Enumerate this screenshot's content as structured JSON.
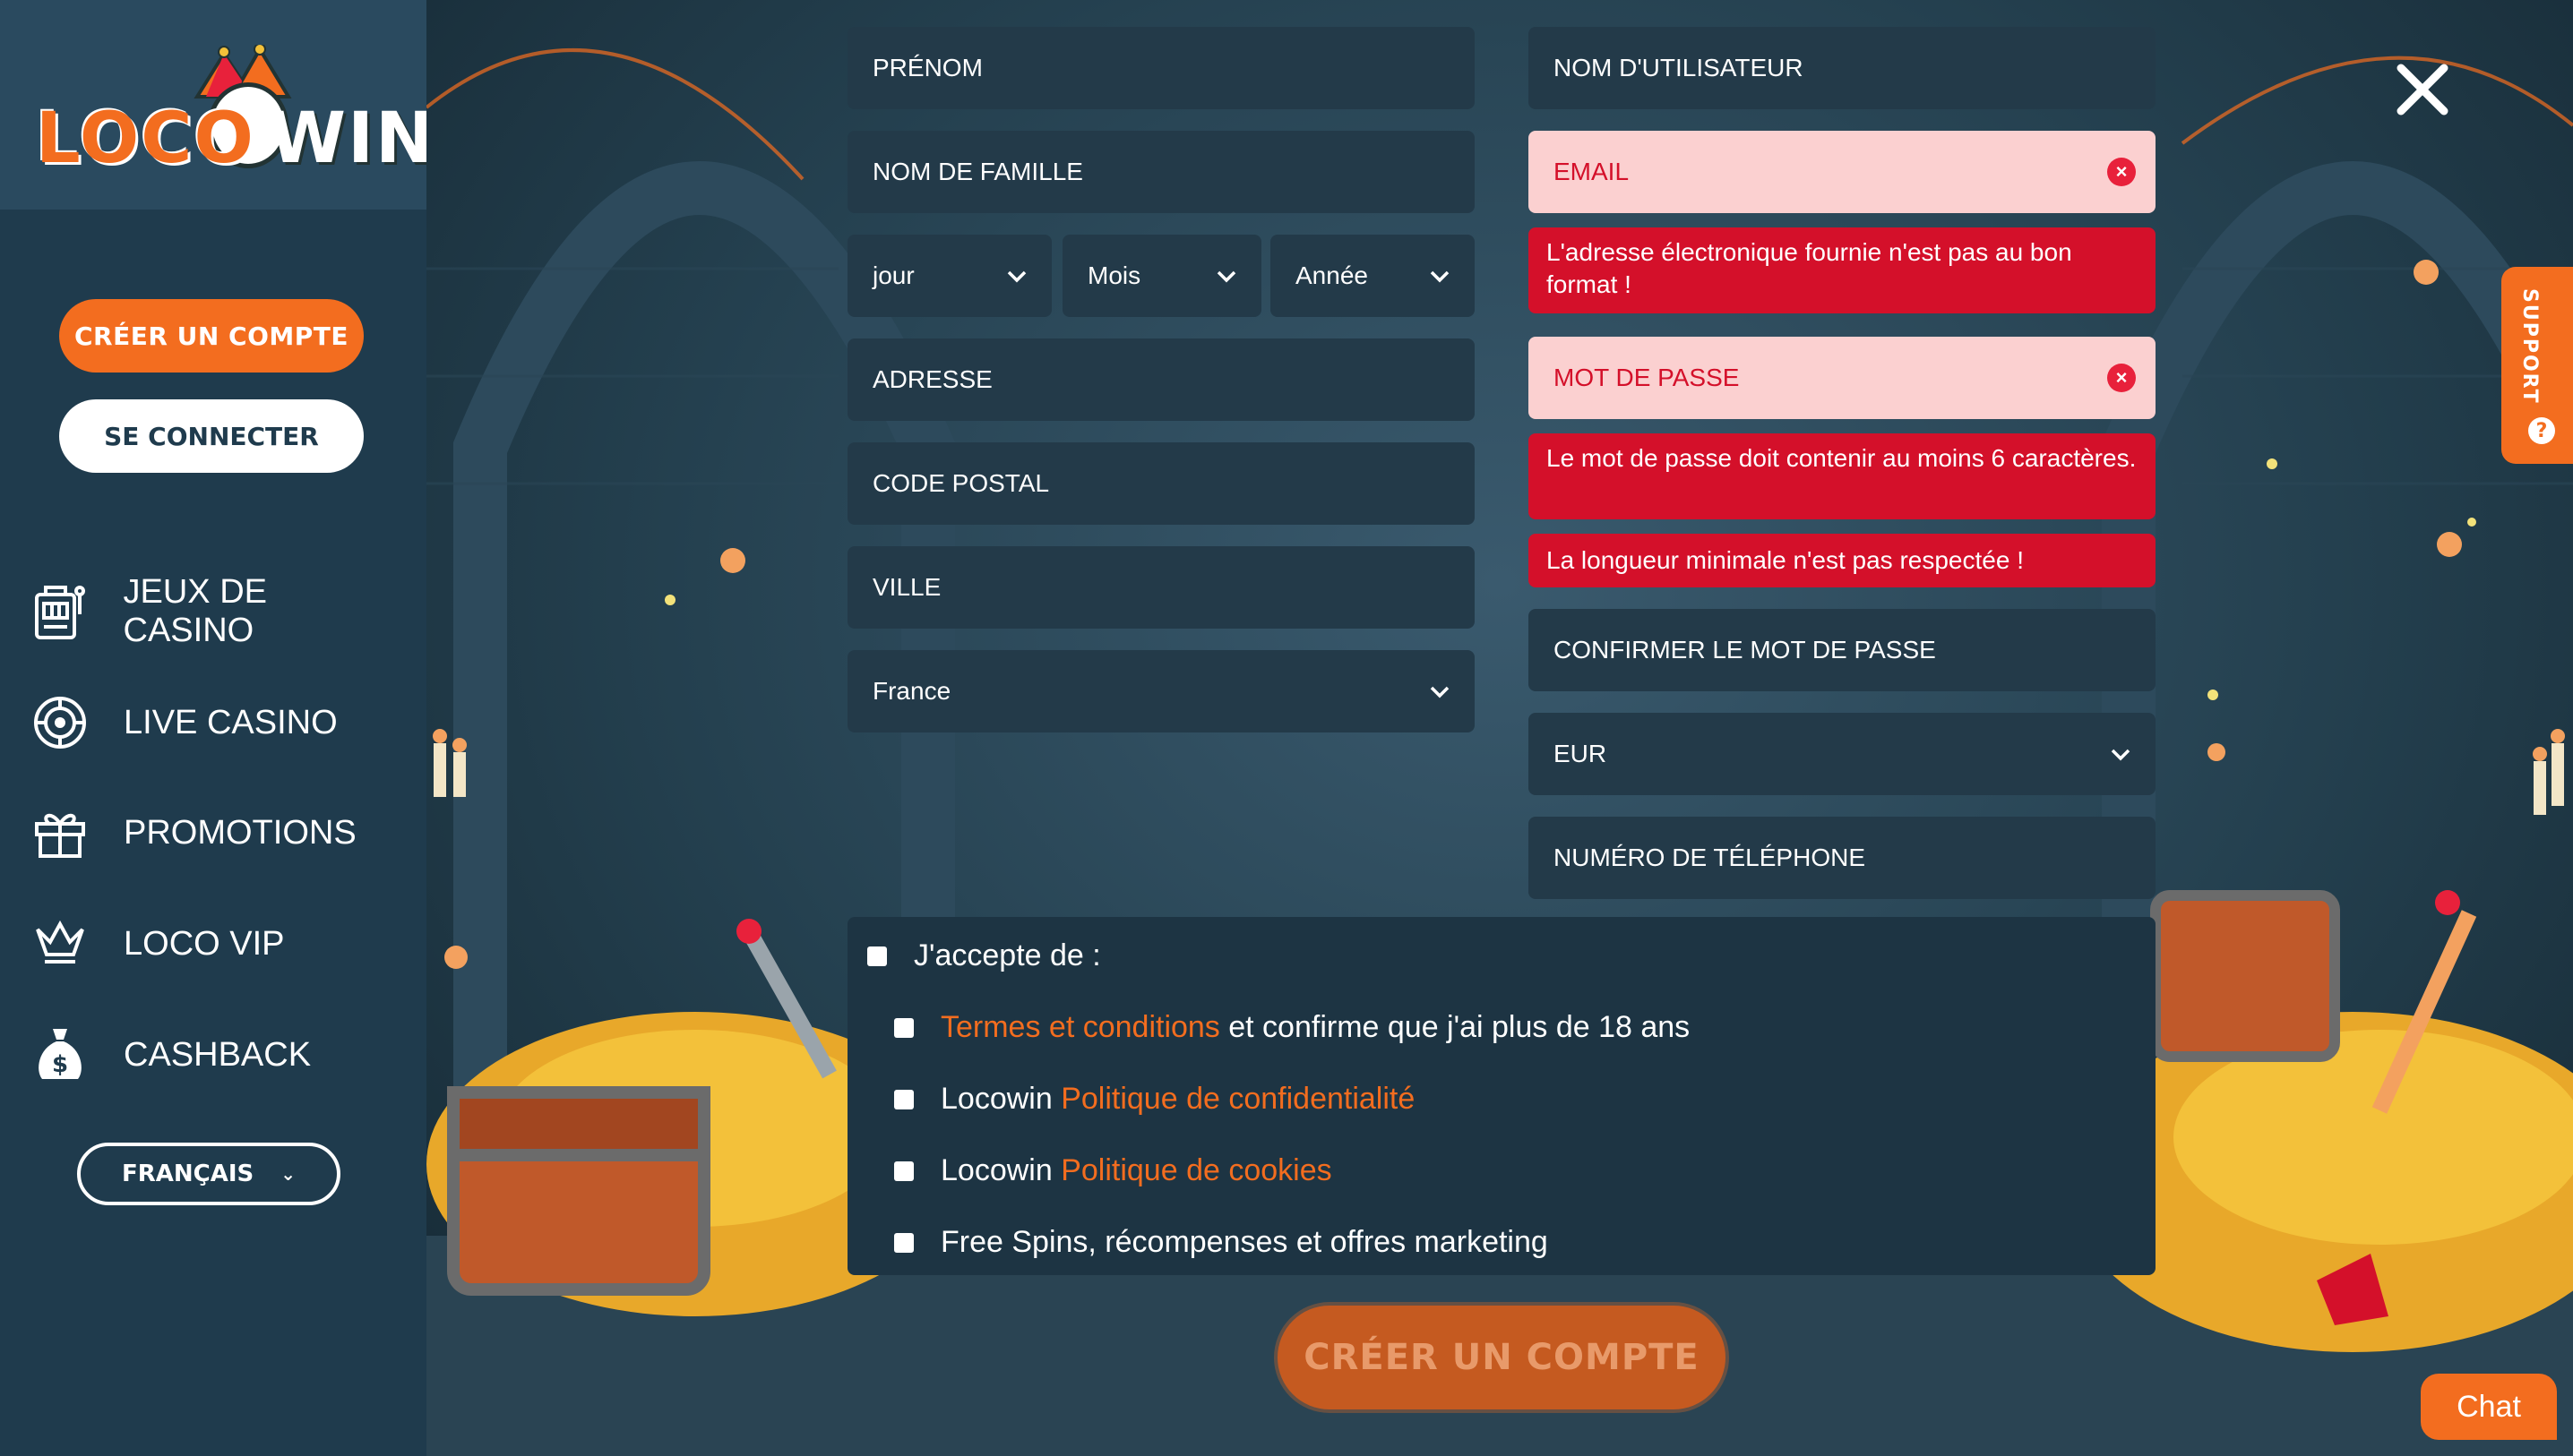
{
  "sidebar": {
    "logo": {
      "part1": "LOCO",
      "part2": "WIN"
    },
    "create_account": "CRÉER UN COMPTE",
    "login": "SE CONNECTER",
    "nav": [
      {
        "label": "JEUX DE CASINO",
        "icon": "slot-machine-icon"
      },
      {
        "label": "LIVE CASINO",
        "icon": "roulette-icon"
      },
      {
        "label": "PROMOTIONS",
        "icon": "gift-icon"
      },
      {
        "label": "LOCO VIP",
        "icon": "crown-icon"
      },
      {
        "label": "CASHBACK",
        "icon": "money-bag-icon"
      }
    ],
    "language": "FRANÇAIS"
  },
  "form": {
    "first_name": "PRÉNOM",
    "last_name": "NOM DE FAMILLE",
    "dob_day": "jour",
    "dob_month": "Mois",
    "dob_year": "Année",
    "address": "ADRESSE",
    "postal_code": "CODE POSTAL",
    "city": "VILLE",
    "country": "France",
    "username": "NOM D'UTILISATEUR",
    "email": "EMAIL",
    "email_error": "L'adresse électronique fournie n'est pas au bon format !",
    "password": "MOT DE PASSE",
    "password_error_1": "Le mot de passe doit contenir au moins 6 caractères.",
    "password_error_2": "La longueur minimale n'est pas respectée !",
    "confirm_password": "CONFIRMER LE MOT DE PASSE",
    "currency": "EUR",
    "phone": "NUMÉRO DE TÉLÉPHONE"
  },
  "consent": {
    "accept_all": "J'accepte de :",
    "terms_link": "Termes et conditions",
    "terms_rest": " et confirme que j'ai plus de 18 ans",
    "privacy_prefix": "Locowin ",
    "privacy_link": "Politique de confidentialité",
    "cookies_prefix": "Locowin ",
    "cookies_link": "Politique de cookies",
    "marketing": "Free Spins, récompenses et offres marketing"
  },
  "submit": "CRÉER UN COMPTE",
  "support": "SUPPORT",
  "chat": "Chat",
  "colors": {
    "accent": "#f36d1f",
    "sidebar": "#1f3b4d",
    "field": "#233a49",
    "error": "#d4102a",
    "error_field": "#fbd0d0"
  }
}
